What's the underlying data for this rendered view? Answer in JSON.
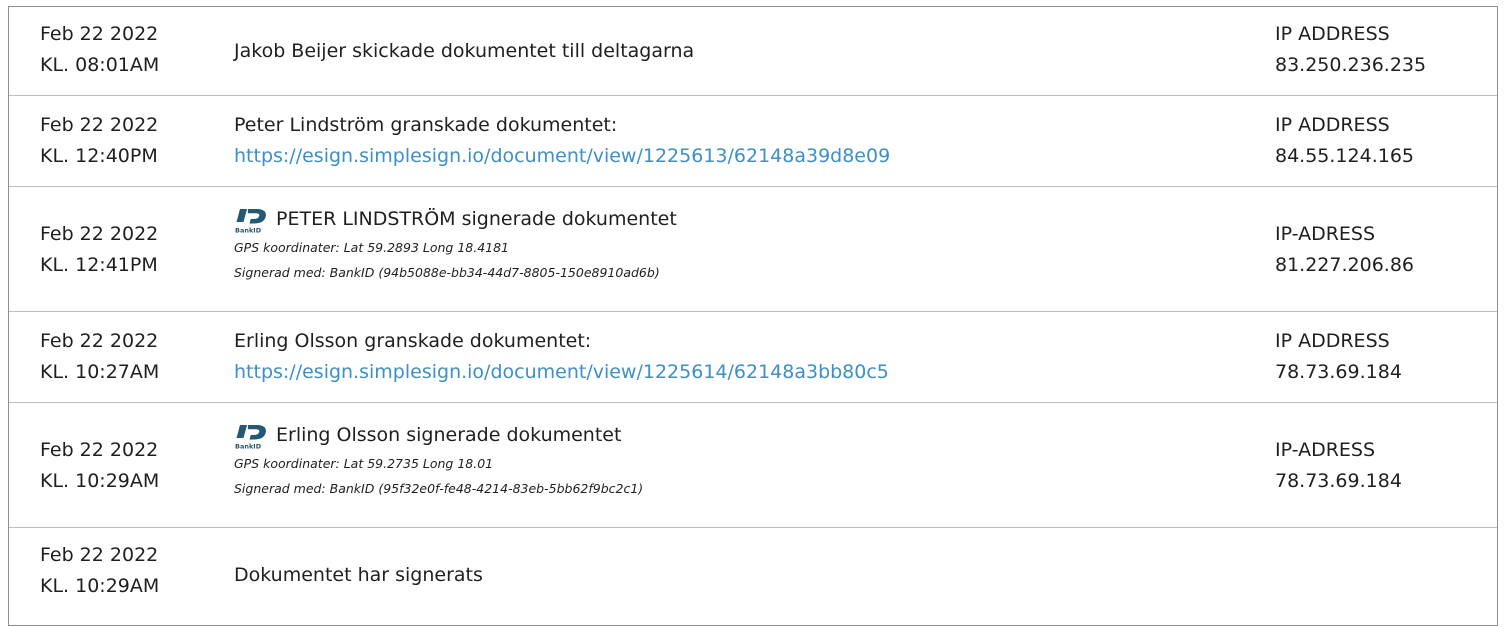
{
  "entries": [
    {
      "date": "Feb 22 2022",
      "time": "KL. 08:01AM",
      "text": "Jakob Beijer skickade dokumentet till deltagarna",
      "ip_label": "IP ADDRESS",
      "ip": "83.250.236.235"
    },
    {
      "date": "Feb 22 2022",
      "time": "KL. 12:40PM",
      "text": "Peter Lindström granskade dokumentet:",
      "link": "https://esign.simplesign.io/document/view/1225613/62148a39d8e09",
      "ip_label": "IP ADDRESS",
      "ip": "84.55.124.165"
    },
    {
      "date": "Feb 22 2022",
      "time": "KL. 12:41PM",
      "text": "PETER LINDSTRÖM signerade dokumentet",
      "gps": "GPS koordinater: Lat 59.2893 Long 18.4181",
      "signed_with": "Signerad med: BankID (94b5088e-bb34-44d7-8805-150e8910ad6b)",
      "ip_label": "IP-ADRESS",
      "ip": "81.227.206.86",
      "icon": "bankid-icon"
    },
    {
      "date": "Feb 22 2022",
      "time": "KL. 10:27AM",
      "text": "Erling Olsson granskade dokumentet:",
      "link": "https://esign.simplesign.io/document/view/1225614/62148a3bb80c5",
      "ip_label": "IP ADDRESS",
      "ip": "78.73.69.184"
    },
    {
      "date": "Feb 22 2022",
      "time": "KL. 10:29AM",
      "text": "Erling Olsson signerade dokumentet",
      "gps": "GPS koordinater: Lat 59.2735 Long 18.01",
      "signed_with": "Signerad med: BankID (95f32e0f-fe48-4214-83eb-5bb62f9bc2c1)",
      "ip_label": "IP-ADRESS",
      "ip": "78.73.69.184",
      "icon": "bankid-icon"
    },
    {
      "date": "Feb 22 2022",
      "time": "KL. 10:29AM",
      "text": "Dokumentet har signerats"
    }
  ],
  "colors": {
    "link": "#3d8fc7",
    "border": "#8f8f8f",
    "divider": "#bdbdbd",
    "bankid_blue": "#235971"
  }
}
